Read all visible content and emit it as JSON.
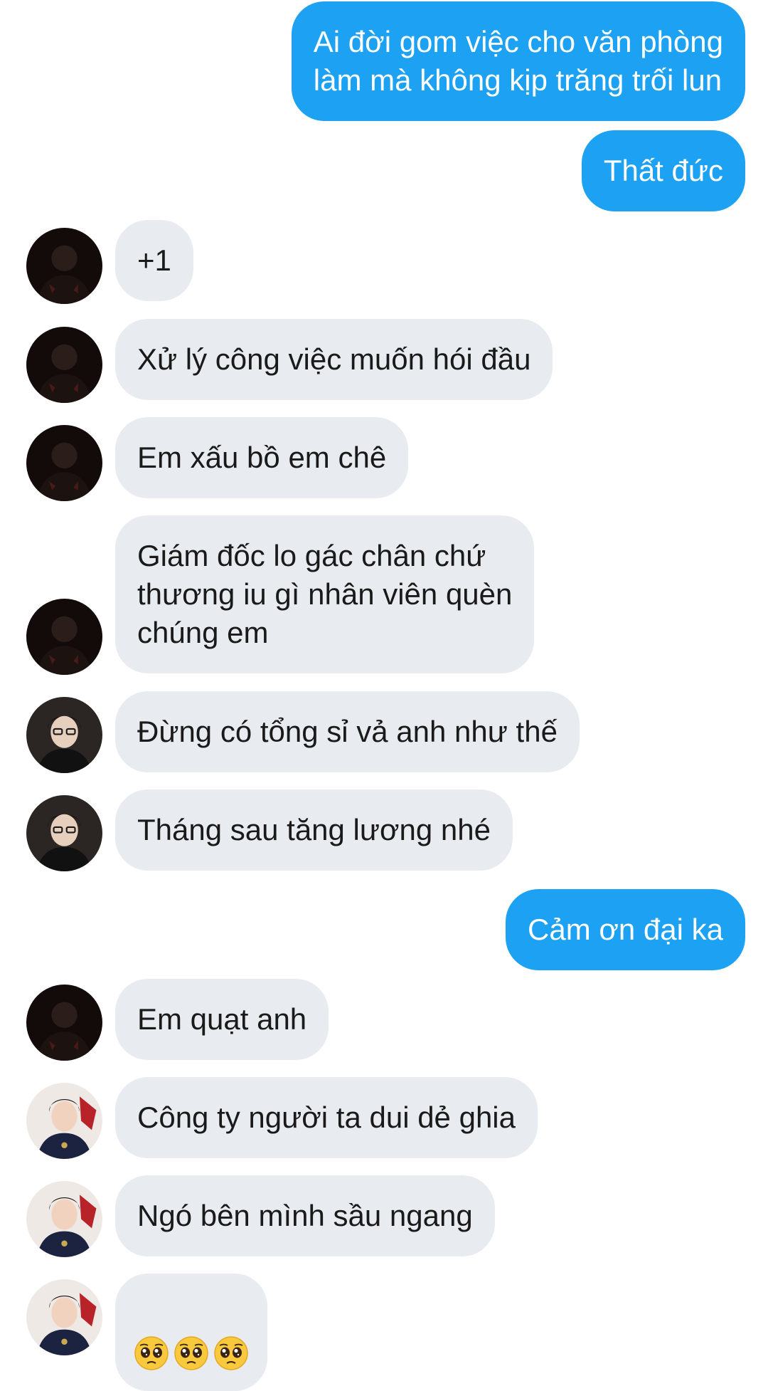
{
  "colors": {
    "outgoing_bubble": "#1da1f2",
    "incoming_bubble": "#e8ecf0"
  },
  "messages": [
    {
      "id": "m1",
      "direction": "out",
      "text": "Ai đời gom việc cho văn phòng\nlàm mà không kịp trăng trối lun"
    },
    {
      "id": "m2",
      "direction": "out",
      "text": "Thất đức"
    },
    {
      "id": "m3",
      "direction": "in",
      "sender_avatar": "dark-avatar-a",
      "text": "+1"
    },
    {
      "id": "m4",
      "direction": "in",
      "sender_avatar": "dark-avatar-a",
      "text": "Xử lý công việc muốn hói đầu"
    },
    {
      "id": "m5",
      "direction": "in",
      "sender_avatar": "dark-avatar-a",
      "text": "Em xấu bồ em chê"
    },
    {
      "id": "m6",
      "direction": "in",
      "sender_avatar": "dark-avatar-a",
      "text": "Giám đốc lo gác chân chứ\nthương iu gì nhân viên quèn\nchúng em"
    },
    {
      "id": "m7",
      "direction": "in",
      "sender_avatar": "glasses-avatar-b",
      "text": "Đừng có tổng sỉ vả anh như thế"
    },
    {
      "id": "m8",
      "direction": "in",
      "sender_avatar": "glasses-avatar-b",
      "text": "Tháng sau tăng lương nhé"
    },
    {
      "id": "m9",
      "direction": "out",
      "text": "Cảm ơn đại ka"
    },
    {
      "id": "m10",
      "direction": "in",
      "sender_avatar": "dark-avatar-a",
      "text": "Em quạt anh"
    },
    {
      "id": "m11",
      "direction": "in",
      "sender_avatar": "light-avatar-c",
      "text": "Công ty người ta dui dẻ ghia"
    },
    {
      "id": "m12",
      "direction": "in",
      "sender_avatar": "light-avatar-c",
      "text": "Ngó bên mình sầu ngang"
    },
    {
      "id": "m13",
      "direction": "in",
      "sender_avatar": "light-avatar-c",
      "emoji": [
        "pleading-face",
        "pleading-face",
        "pleading-face"
      ]
    }
  ]
}
